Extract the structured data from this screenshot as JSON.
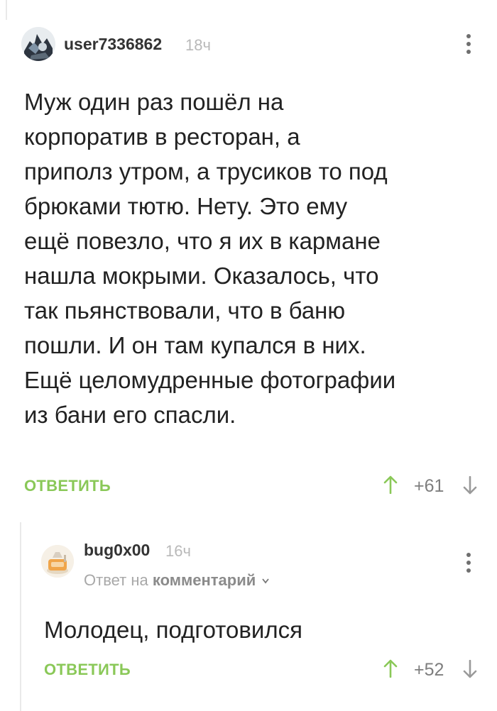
{
  "comment": {
    "username": "user7336862",
    "time": "18ч",
    "avatar_icon": "user-avatar-icon",
    "text_lines": [
      "Муж один раз пошёл на",
      "корпоратив в ресторан, а",
      "приполз утром, а трусиков то под",
      "брюками тютю. Нету. Это ему",
      "ещё повезло, что я их в кармане",
      "нашла мокрыми. Оказалось, что",
      "так пьянствовали, что в баню",
      "пошли. И он там купался в них.",
      "Ещё целомудренные фотографии",
      "из бани его спасли."
    ],
    "reply_label": "ОТВЕТИТЬ",
    "rating": "+61"
  },
  "reply": {
    "username": "bug0x00",
    "time": "16ч",
    "avatar_icon": "user-avatar-icon",
    "reply_to_prefix": "Ответ на",
    "reply_to_link": "комментарий",
    "text": "Молодец, подготовился",
    "reply_label": "ОТВЕТИТЬ",
    "rating": "+52"
  },
  "colors": {
    "accent_green": "#8ac858",
    "text": "#222222",
    "muted": "#b9b9b9",
    "thread_line": "#e9e9e9"
  }
}
